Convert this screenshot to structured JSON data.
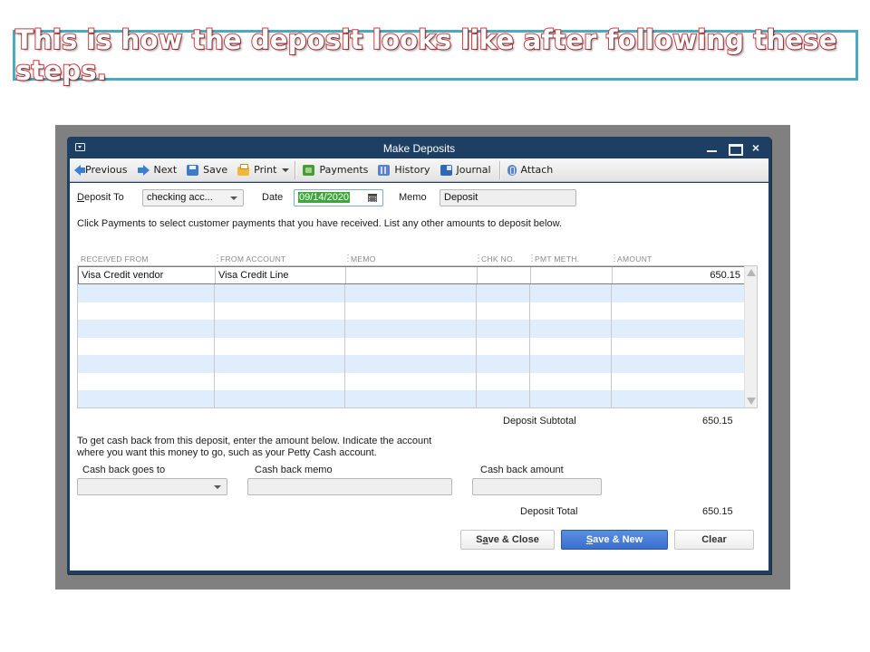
{
  "caption": "This is how the deposit looks like after following these steps.",
  "window": {
    "title": "Make Deposits",
    "controls": {
      "minimize": "minimize",
      "maximize": "maximize",
      "close": "×"
    }
  },
  "toolbar": {
    "items": [
      {
        "label": "Previous",
        "icon": "arrow-left-icon"
      },
      {
        "label": "Next",
        "icon": "arrow-right-icon"
      },
      {
        "label": "Save",
        "icon": "save-icon"
      },
      {
        "label": "Print",
        "icon": "print-icon"
      },
      {
        "label": "Payments",
        "icon": "payments-icon"
      },
      {
        "label": "History",
        "icon": "history-icon"
      },
      {
        "label": "Journal",
        "icon": "journal-icon"
      },
      {
        "label": "Attach",
        "icon": "attach-icon"
      }
    ]
  },
  "form": {
    "deposit_to_label_accel": "D",
    "deposit_to_label_rest": "eposit To",
    "deposit_to_value": "checking acc...",
    "date_label": "Date",
    "date_value": "09/14/2020",
    "memo_label": "Memo",
    "memo_value": "Deposit",
    "instructions": "Click Payments to select customer payments that you have received. List any other amounts to deposit below."
  },
  "grid": {
    "columns": [
      "RECEIVED FROM",
      "FROM ACCOUNT",
      "MEMO",
      "CHK NO.",
      "PMT METH.",
      "AMOUNT"
    ],
    "rows": [
      {
        "received_from": "Visa Credit vendor",
        "from_account": "Visa Credit Line",
        "memo": "",
        "chk_no": "",
        "pmt_meth": "",
        "amount": "650.15"
      }
    ]
  },
  "totals": {
    "subtotal_label": "Deposit Subtotal",
    "subtotal_value": "650.15",
    "total_label": "Deposit Total",
    "total_value": "650.15"
  },
  "cash_back": {
    "instructions_line1": "To get cash back from this deposit, enter the amount below.  Indicate the account",
    "instructions_line2": "where you want this money to go, such as your Petty Cash account.",
    "goes_to_label": "Cash back goes to",
    "goes_to_value": "",
    "memo_label": "Cash back memo",
    "memo_value": "",
    "amount_label": "Cash back amount",
    "amount_value": ""
  },
  "buttons": {
    "save_close_pre": "S",
    "save_close_accel": "a",
    "save_close_post": "ve & Close",
    "save_new_accel": "S",
    "save_new_post": "ave & New",
    "clear": "Clear"
  },
  "colors": {
    "caption_red": "#d0393e",
    "caption_border": "#4aabc0",
    "window_frame": "#1d3f63",
    "primary_button": "#3a6fcf",
    "date_highlight": "#3fa63a",
    "grid_alt_row": "#e0edfc"
  }
}
